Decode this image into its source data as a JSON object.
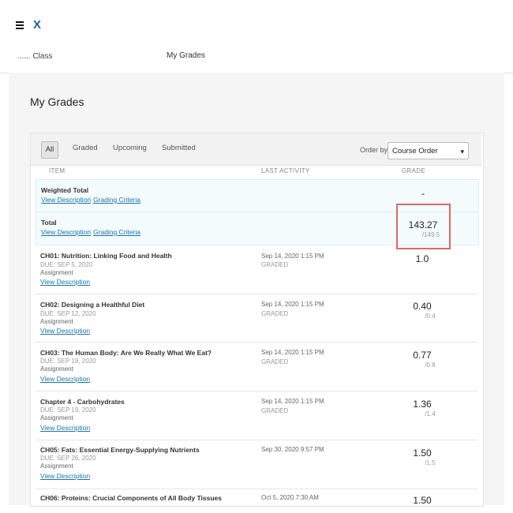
{
  "header": {
    "logo_glyph": "X",
    "course_crumb": "Class",
    "center_nav": "My Grades"
  },
  "page_title": "My Grades",
  "tabs": [
    "All",
    "Graded",
    "Upcoming",
    "Submitted"
  ],
  "order_by": {
    "label": "Order by:",
    "selected": "Course Order"
  },
  "columns": {
    "item": "ITEM",
    "last_activity": "LAST ACTIVITY",
    "grade": "GRADE"
  },
  "links": {
    "view_description": "View Description",
    "grading_criteria": "Grading Criteria"
  },
  "summary": {
    "weighted_total": {
      "title": "Weighted Total",
      "grade": "-"
    },
    "total": {
      "title": "Total",
      "grade": "143.27",
      "possible": "/149.5"
    }
  },
  "items": [
    {
      "title": "CH01: Nutrition: Linking Food and Health",
      "due": "DUE: SEP 5, 2020",
      "type": "Assignment",
      "activity": "Sep 14, 2020 1:15 PM",
      "status": "GRADED",
      "grade": "1.0",
      "possible": ""
    },
    {
      "title": "CH02: Designing a Healthful Diet",
      "due": "DUE: SEP 12, 2020",
      "type": "Assignment",
      "activity": "Sep 14, 2020 1:15 PM",
      "status": "GRADED",
      "grade": "0.40",
      "possible": "/0.4"
    },
    {
      "title": "CH03: The Human Body: Are We Really What We Eat?",
      "due": "DUE: SEP 19, 2020",
      "type": "Assignment",
      "activity": "Sep 14, 2020 1:15 PM",
      "status": "GRADED",
      "grade": "0.77",
      "possible": "/0.8"
    },
    {
      "title": "Chapter 4 - Carbohydrates",
      "due": "DUE: SEP 19, 2020",
      "type": "Assignment",
      "activity": "Sep 14, 2020 1:15 PM",
      "status": "GRADED",
      "grade": "1.36",
      "possible": "/1.4"
    },
    {
      "title": "CH05: Fats: Essential Energy-Supplying Nutrients",
      "due": "DUE: SEP 26, 2020",
      "type": "Assignment",
      "activity": "Sep 30, 2020 9:57 PM",
      "status": "",
      "grade": "1.50",
      "possible": "/1.5"
    },
    {
      "title": "CH06: Proteins: Crucial Components of All Body Tissues",
      "due": "",
      "type": "",
      "activity": "Oct 5, 2020 7:30 AM",
      "status": "",
      "grade": "1.50",
      "possible": ""
    }
  ]
}
